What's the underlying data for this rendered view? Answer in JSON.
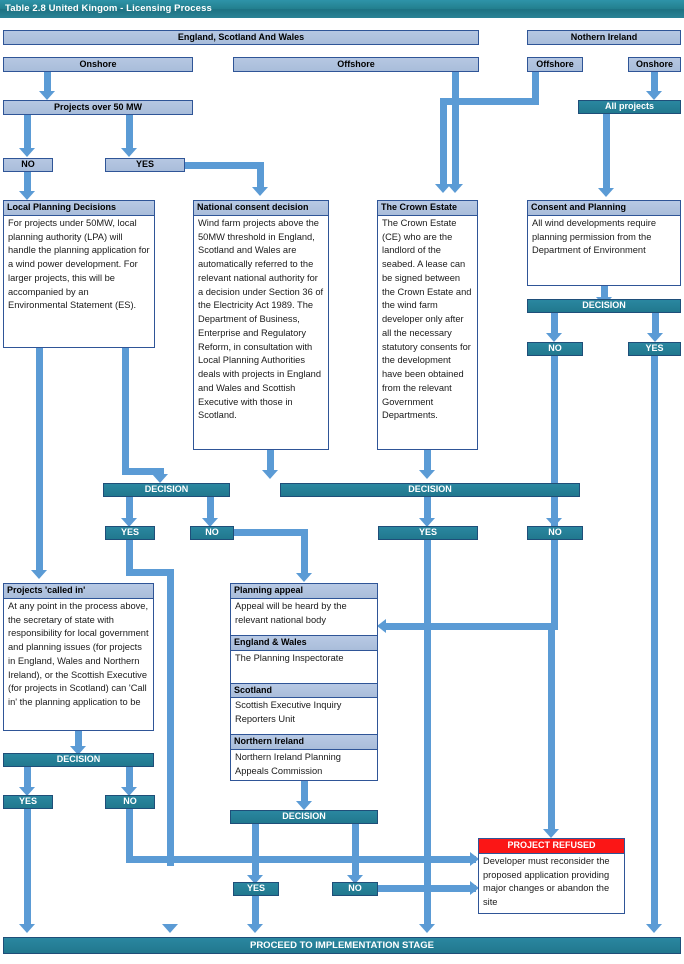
{
  "title": "Table 2.8 United Kingom - Licensing Process",
  "regions": {
    "esw": "England, Scotland And Wales",
    "ni": "Nothern Ireland"
  },
  "branches": {
    "esw_onshore": "Onshore",
    "esw_offshore": "Offshore",
    "ni_offshore": "Offshore",
    "ni_onshore": "Onshore"
  },
  "threshold": {
    "projects_over_50mw": "Projects over 50 MW",
    "no": "NO",
    "yes": "YES"
  },
  "ni_all_projects": "All projects",
  "cards": {
    "local_planning": {
      "head": "Local Planning Decisions",
      "body": "For projects under 50MW, local planning authority (LPA) will handle the planning application for a wind power development. For larger projects, this will be accompanied by an Environmental Statement (ES)."
    },
    "national_consent": {
      "head": "National consent decision",
      "body": "Wind farm projects above the 50MW threshold in England, Scotland and Wales are automatically referred to the relevant national authority for a decision under Section 36 of the Electricity Act 1989. The Department of Business, Enterprise and Regulatory Reform, in consultation with Local Planning Authorities deals with projects in England and Wales and Scottish Executive with those in Scotland."
    },
    "crown_estate": {
      "head": "The Crown Estate",
      "body": "The Crown Estate (CE) who are the landlord of the seabed. A lease can be signed between the Crown Estate and the wind farm developer only after all the necessary statutory consents for the development have been obtained from the relevant Government Departments."
    },
    "consent_planning": {
      "head": "Consent and Planning",
      "body": "All wind developments require planning permission from the Department of Environment"
    },
    "called_in": {
      "head": "Projects 'called in'",
      "body": "At any point in the process above, the secretary of state with responsibility for local government and planning issues (for projects in England, Wales and Northern Ireland), or the Scottish Executive (for projects in Scotland) can 'Call in' the planning application to be"
    },
    "project_refused": {
      "head": "PROJECT REFUSED",
      "body": "Developer must reconsider the proposed application providing major changes or abandon the site"
    }
  },
  "appeal": {
    "head": "Planning appeal",
    "body": "Appeal will be heard by the relevant national body",
    "rows": [
      {
        "head": "England & Wales",
        "body": "The Planning Inspectorate"
      },
      {
        "head": "Scotland",
        "body": "Scottish Executive Inquiry Reporters Unit"
      },
      {
        "head": "Northern Ireland",
        "body": "Northern Ireland Planning Appeals Commission"
      }
    ]
  },
  "decisions": {
    "label": "DECISION",
    "yes": "YES",
    "no": "NO"
  },
  "footer": "PROCEED TO IMPLEMENTATION STAGE",
  "colors": {
    "title_bar": "#23808f",
    "light_blue_box": "#a9bdda",
    "teal_box": "#21788e",
    "connector": "#5b9bd5",
    "refused_banner": "#fb1616",
    "border_blue": "#2f5597"
  }
}
